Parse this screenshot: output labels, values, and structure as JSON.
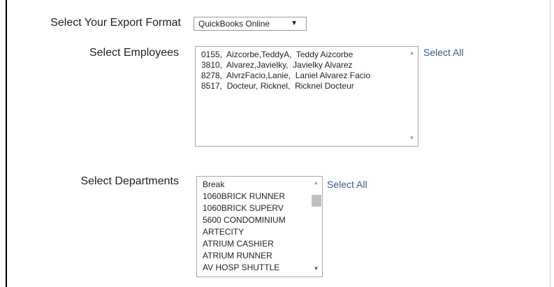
{
  "form": {
    "export_format": {
      "label": "Select Your Export Format",
      "selected": "QuickBooks Online"
    },
    "employees": {
      "label": "Select Employees",
      "items": [
        "0155,  Aizcorbe,TeddyA,  Teddy Aizcorbe",
        "3810,  Alvarez,Javielky,  Javielky Alvarez",
        "8278,  AlvrzFacio,Lanie,  Laniel Alvarez Facio",
        "8517,  Docteur, Ricknel,  Ricknel Docteur"
      ],
      "select_all": "Select All"
    },
    "departments": {
      "label": "Select Departments",
      "items": [
        "Break",
        "1060BRICK RUNNER",
        "1060BRICK SUPERV",
        "5600 CONDOMINIUM",
        "ARTECITY",
        "ATRIUM CASHIER",
        "ATRIUM RUNNER",
        "AV HOSP SHUTTLE"
      ],
      "select_all": "Select All"
    }
  },
  "icons": {
    "dropdown_arrow": "▼",
    "scroll_up": "▲",
    "scroll_down": "▼"
  },
  "colors": {
    "link": "#3a5a8c",
    "border": "#a9a9a9",
    "scroll_thumb": "#c1c1c1"
  }
}
